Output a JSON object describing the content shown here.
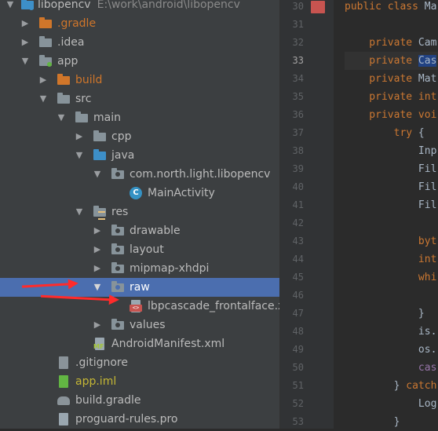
{
  "project_tree": {
    "items": [
      {
        "label": "libopencv",
        "path": "E:\\work\\android\\libopencv",
        "selected": false
      },
      {
        "label": ".gradle",
        "selected": false
      },
      {
        "label": ".idea",
        "selected": false
      },
      {
        "label": "app",
        "selected": false
      },
      {
        "label": "build",
        "selected": false
      },
      {
        "label": "src",
        "selected": false
      },
      {
        "label": "main",
        "selected": false
      },
      {
        "label": "cpp",
        "selected": false
      },
      {
        "label": "java",
        "selected": false
      },
      {
        "label": "com.north.light.libopencv",
        "selected": false
      },
      {
        "label": "MainActivity",
        "selected": false
      },
      {
        "label": "res",
        "selected": false
      },
      {
        "label": "drawable",
        "selected": false
      },
      {
        "label": "layout",
        "selected": false
      },
      {
        "label": "mipmap-xhdpi",
        "selected": false
      },
      {
        "label": "raw",
        "selected": true
      },
      {
        "label": "lbpcascade_frontalface.xml",
        "selected": false
      },
      {
        "label": "values",
        "selected": false
      },
      {
        "label": "AndroidManifest.xml",
        "selected": false
      },
      {
        "label": ".gitignore",
        "selected": false
      },
      {
        "label": "app.iml",
        "selected": false
      },
      {
        "label": "build.gradle",
        "selected": false
      },
      {
        "label": "proguard-rules.pro",
        "selected": false
      }
    ]
  },
  "icons": {
    "class_letter": "C",
    "xml_tag": "<>",
    "manifest_mark": "MF"
  },
  "editor": {
    "line_numbers": [
      "30",
      "31",
      "32",
      "33",
      "34",
      "35",
      "36",
      "37",
      "38",
      "39",
      "40",
      "41",
      "42",
      "43",
      "44",
      "45",
      "46",
      "47",
      "48",
      "49",
      "50",
      "51",
      "52",
      "53"
    ],
    "current_line": "33",
    "code_lines": [
      [
        {
          "t": "public class ",
          "c": "kw"
        },
        {
          "t": "Ma",
          "c": "pl"
        }
      ],
      [],
      [
        {
          "t": "    private ",
          "c": "kw"
        },
        {
          "t": "Cam",
          "c": "pl"
        }
      ],
      [
        {
          "t": "    private ",
          "c": "kw"
        },
        {
          "t": "Cas",
          "c": "hl"
        }
      ],
      [
        {
          "t": "    private ",
          "c": "kw"
        },
        {
          "t": "Mat",
          "c": "pl"
        }
      ],
      [
        {
          "t": "    private ",
          "c": "kw"
        },
        {
          "t": "int",
          "c": "kw"
        }
      ],
      [
        {
          "t": "    private ",
          "c": "kw"
        },
        {
          "t": "voi",
          "c": "kw"
        }
      ],
      [
        {
          "t": "        try ",
          "c": "kw"
        },
        {
          "t": "{",
          "c": "pl"
        }
      ],
      [
        {
          "t": "            Inp",
          "c": "pl"
        }
      ],
      [
        {
          "t": "            Fil",
          "c": "pl"
        }
      ],
      [
        {
          "t": "            Fil",
          "c": "pl"
        }
      ],
      [
        {
          "t": "            Fil",
          "c": "pl"
        }
      ],
      [],
      [
        {
          "t": "            byt",
          "c": "kw"
        }
      ],
      [
        {
          "t": "            int",
          "c": "kw"
        }
      ],
      [
        {
          "t": "            whi",
          "c": "kw"
        }
      ],
      [],
      [
        {
          "t": "            }",
          "c": "pl"
        }
      ],
      [
        {
          "t": "            is.",
          "c": "pl"
        }
      ],
      [
        {
          "t": "            os.",
          "c": "pl"
        }
      ],
      [
        {
          "t": "            cas",
          "c": "fl"
        }
      ],
      [
        {
          "t": "        } ",
          "c": "pl"
        },
        {
          "t": "catch",
          "c": "kw"
        }
      ],
      [
        {
          "t": "            Log",
          "c": "pl"
        }
      ],
      [
        {
          "t": "        }",
          "c": "pl"
        }
      ]
    ]
  },
  "colors": {
    "selection": "#4b6eaf",
    "annotation_arrow": "#ff2b2b",
    "module_folder": "#d0762a",
    "source_folder": "#3d8fc8"
  }
}
